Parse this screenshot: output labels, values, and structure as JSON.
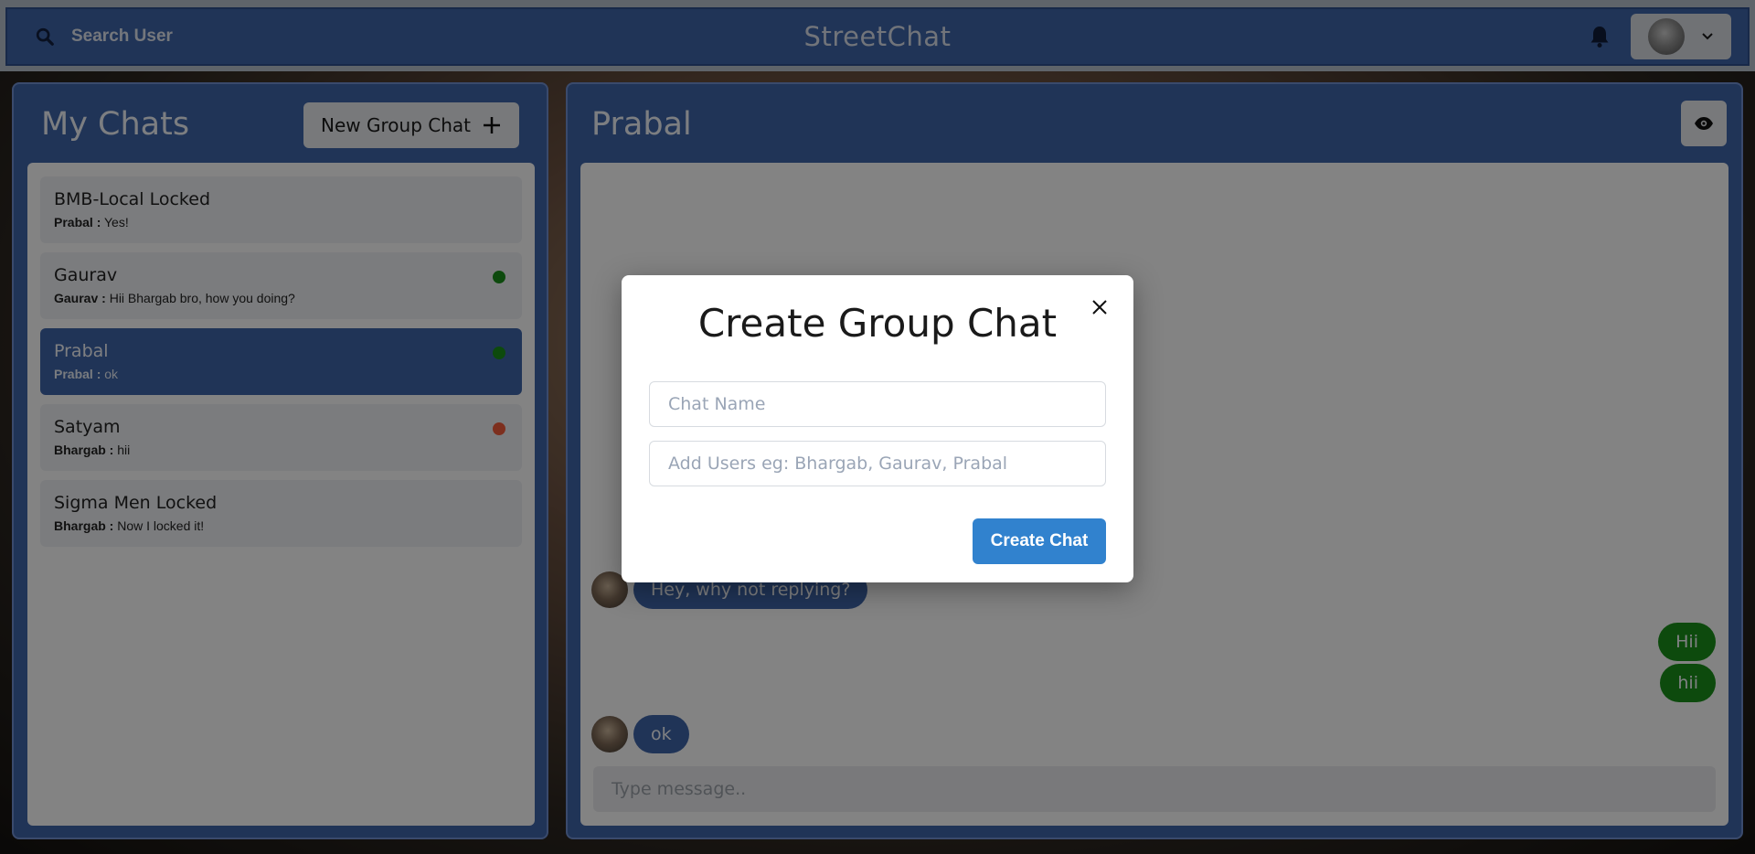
{
  "app": {
    "brand": "StreetChat"
  },
  "header": {
    "search_label": "Search User",
    "icons": {
      "search": "search-icon",
      "bell": "bell-icon",
      "chevron": "chevron-down-icon"
    }
  },
  "sidebar": {
    "title": "My Chats",
    "new_group_label": "New Group Chat",
    "chats": [
      {
        "name": "BMB-Local Locked",
        "sender": "Prabal :",
        "message": "Yes!",
        "status": null
      },
      {
        "name": "Gaurav",
        "sender": "Gaurav :",
        "message": "Hii Bhargab bro, how you doing?",
        "status": "online"
      },
      {
        "name": "Prabal",
        "sender": "Prabal :",
        "message": "ok",
        "status": "online",
        "active": true
      },
      {
        "name": "Satyam",
        "sender": "Bhargab :",
        "message": "hii",
        "status": "offline"
      },
      {
        "name": "Sigma Men Locked",
        "sender": "Bhargab :",
        "message": "Now I locked it!",
        "status": null
      }
    ]
  },
  "chat": {
    "title": "Prabal",
    "messages": [
      {
        "text": "Hey, why not replying?",
        "direction": "in"
      },
      {
        "text": "Hii",
        "direction": "out"
      },
      {
        "text": "hii",
        "direction": "out"
      },
      {
        "text": "ok",
        "direction": "in"
      }
    ],
    "input_placeholder": "Type message.."
  },
  "modal": {
    "title": "Create Group Chat",
    "chat_name_placeholder": "Chat Name",
    "add_users_placeholder": "Add Users eg: Bhargab, Gaurav, Prabal",
    "create_label": "Create Chat"
  },
  "colors": {
    "primary": "#3f64a8",
    "online": "#1a8f1a",
    "offline": "#f05a3a",
    "button": "#3182ce"
  }
}
